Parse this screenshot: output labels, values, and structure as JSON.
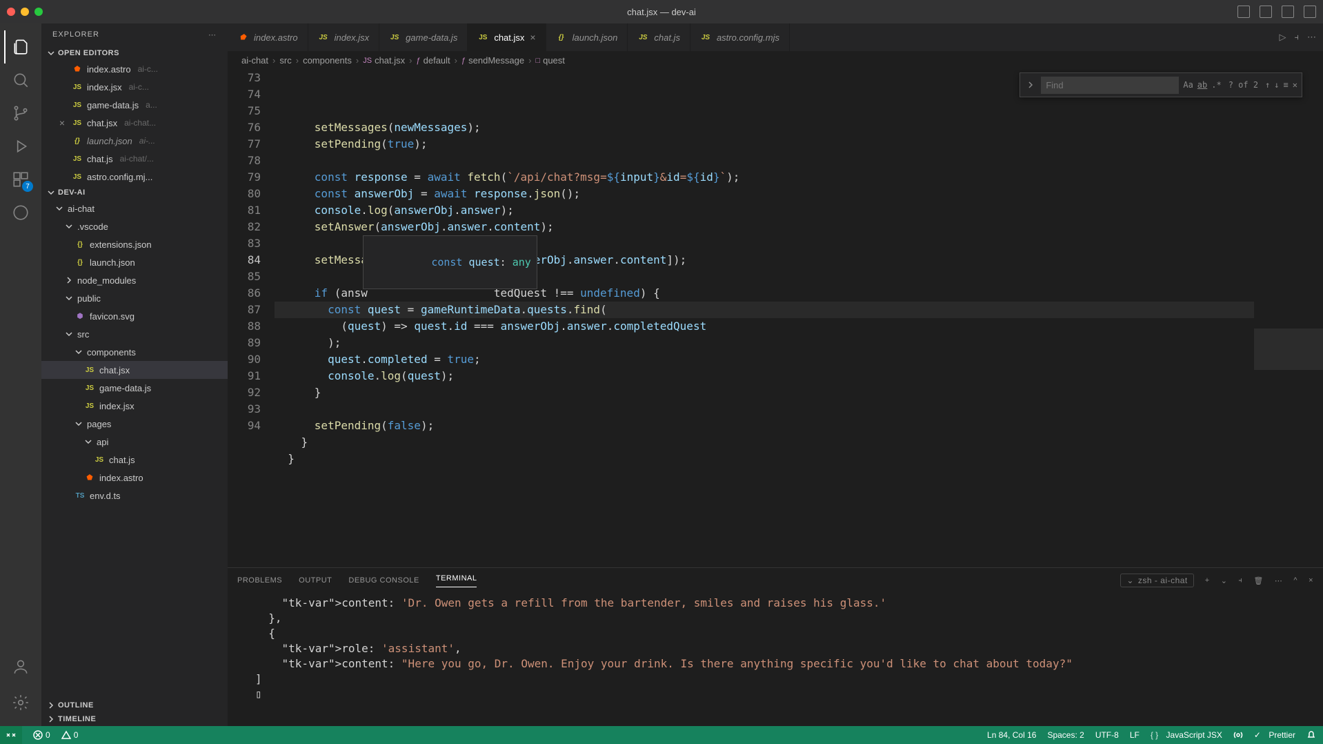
{
  "window": {
    "title": "chat.jsx — dev-ai"
  },
  "activitybar": {
    "badge": "7"
  },
  "sidebar": {
    "title": "EXPLORER",
    "openEditors": {
      "title": "OPEN EDITORS",
      "items": [
        {
          "icon": "astro",
          "name": "index.astro",
          "desc": "ai-c..."
        },
        {
          "icon": "js",
          "name": "index.jsx",
          "desc": "ai-c..."
        },
        {
          "icon": "js",
          "name": "game-data.js",
          "desc": "a..."
        },
        {
          "icon": "js",
          "name": "chat.jsx",
          "desc": "ai-chat...",
          "active": true
        },
        {
          "icon": "json",
          "name": "launch.json",
          "desc": "ai-...",
          "italic": true
        },
        {
          "icon": "js",
          "name": "chat.js",
          "desc": "ai-chat/..."
        },
        {
          "icon": "js",
          "name": "astro.config.mj...",
          "desc": ""
        }
      ]
    },
    "project": {
      "name": "DEV-AI",
      "tree": [
        {
          "depth": 0,
          "kind": "folder",
          "name": "ai-chat",
          "open": true
        },
        {
          "depth": 1,
          "kind": "folder",
          "name": ".vscode",
          "open": true
        },
        {
          "depth": 2,
          "kind": "file",
          "icon": "json",
          "name": "extensions.json"
        },
        {
          "depth": 2,
          "kind": "file",
          "icon": "json",
          "name": "launch.json"
        },
        {
          "depth": 1,
          "kind": "folder",
          "name": "node_modules",
          "open": false
        },
        {
          "depth": 1,
          "kind": "folder",
          "name": "public",
          "open": true
        },
        {
          "depth": 2,
          "kind": "file",
          "icon": "svg",
          "name": "favicon.svg"
        },
        {
          "depth": 1,
          "kind": "folder",
          "name": "src",
          "open": true
        },
        {
          "depth": 2,
          "kind": "folder",
          "name": "components",
          "open": true
        },
        {
          "depth": 3,
          "kind": "file",
          "icon": "js",
          "name": "chat.jsx",
          "selected": true
        },
        {
          "depth": 3,
          "kind": "file",
          "icon": "js",
          "name": "game-data.js"
        },
        {
          "depth": 3,
          "kind": "file",
          "icon": "js",
          "name": "index.jsx"
        },
        {
          "depth": 2,
          "kind": "folder",
          "name": "pages",
          "open": true
        },
        {
          "depth": 3,
          "kind": "folder",
          "name": "api",
          "open": true
        },
        {
          "depth": 4,
          "kind": "file",
          "icon": "js",
          "name": "chat.js"
        },
        {
          "depth": 3,
          "kind": "file",
          "icon": "astro",
          "name": "index.astro"
        },
        {
          "depth": 2,
          "kind": "file",
          "icon": "ts",
          "name": "env.d.ts"
        }
      ]
    },
    "outline": "OUTLINE",
    "timeline": "TIMELINE"
  },
  "tabs": [
    {
      "icon": "astro",
      "label": "index.astro",
      "italic": true
    },
    {
      "icon": "js",
      "label": "index.jsx",
      "italic": true
    },
    {
      "icon": "js",
      "label": "game-data.js",
      "italic": true
    },
    {
      "icon": "js",
      "label": "chat.jsx",
      "active": true
    },
    {
      "icon": "json",
      "label": "launch.json",
      "italic": true
    },
    {
      "icon": "js",
      "label": "chat.js",
      "italic": true
    },
    {
      "icon": "js",
      "label": "astro.config.mjs",
      "italic": true
    }
  ],
  "breadcrumb": [
    "ai-chat",
    "src",
    "components",
    "chat.jsx",
    "default",
    "sendMessage",
    "quest"
  ],
  "find": {
    "placeholder": "Find",
    "count": "? of 2"
  },
  "hover": "const quest: any",
  "code": {
    "start": 73,
    "currentLine": 84,
    "lines": [
      "      setMessages(newMessages);",
      "      setPending(true);",
      "",
      "      const response = await fetch(`/api/chat?msg=${input}&id=${id}`);",
      "      const answerObj = await response.json();",
      "      console.log(answerObj.answer);",
      "      setAnswer(answerObj.answer.content);",
      "",
      "      setMessages([...newMessages, answerObj.answer.content]);",
      "",
      "      if (answ                   tedQuest !== undefined) {",
      "        const quest = gameRuntimeData.quests.find(",
      "          (quest) => quest.id === answerObj.answer.completedQuest",
      "        );",
      "        quest.completed = true;",
      "        console.log(quest);",
      "      }",
      "",
      "      setPending(false);",
      "    }",
      "  }",
      ""
    ]
  },
  "panel": {
    "tabs": [
      "PROBLEMS",
      "OUTPUT",
      "DEBUG CONSOLE",
      "TERMINAL"
    ],
    "active": "TERMINAL",
    "process": "zsh - ai-chat",
    "content": [
      "    content: 'Dr. Owen gets a refill from the bartender, smiles and raises his glass.'",
      "  },",
      "  {",
      "    role: 'assistant',",
      "    content: \"Here you go, Dr. Owen. Enjoy your drink. Is there anything specific you'd like to chat about today?\"",
      "]",
      "▯"
    ]
  },
  "status": {
    "errors": "0",
    "warnings": "0",
    "cursor": "Ln 84, Col 16",
    "spaces": "Spaces: 2",
    "encoding": "UTF-8",
    "eol": "LF",
    "lang": "JavaScript JSX",
    "prettier": "Prettier"
  }
}
